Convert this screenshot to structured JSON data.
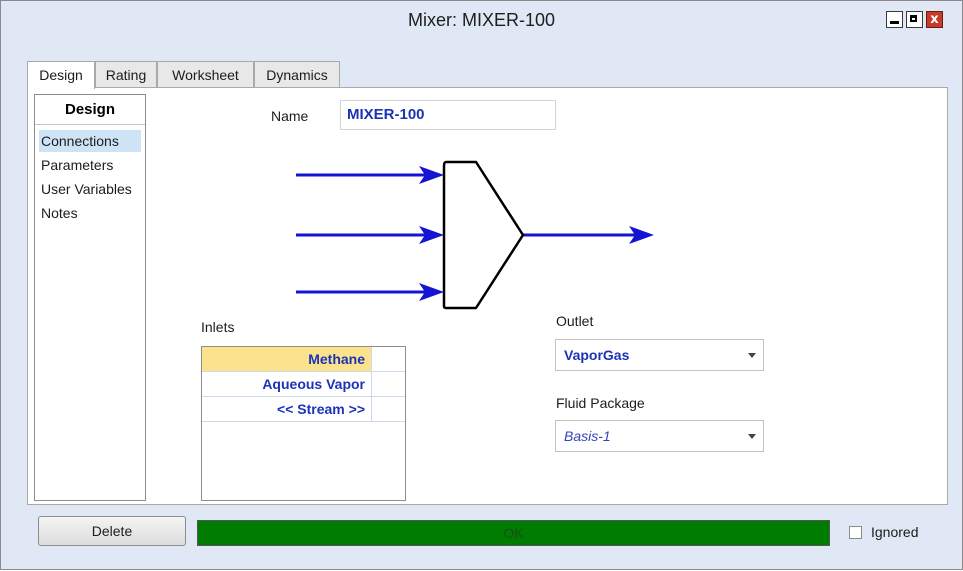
{
  "window": {
    "title": "Mixer: MIXER-100",
    "close_glyph": "x"
  },
  "tabs": [
    "Design",
    "Rating",
    "Worksheet",
    "Dynamics"
  ],
  "sidenav": {
    "title": "Design",
    "items": [
      "Connections",
      "Parameters",
      "User Variables",
      "Notes"
    ]
  },
  "name_field": {
    "label": "Name",
    "value": "MIXER-100"
  },
  "inlets": {
    "label": "Inlets",
    "rows": [
      "Methane",
      "Aqueous Vapor",
      "<< Stream >>"
    ]
  },
  "outlet": {
    "label": "Outlet",
    "value": "VaporGas"
  },
  "fluid_package": {
    "label": "Fluid Package",
    "value": "Basis-1"
  },
  "footer": {
    "delete_label": "Delete",
    "status_text": "OK",
    "ignored_label": "Ignored"
  },
  "colors": {
    "stream_arrow": "#1414d2",
    "status_ok": "#007d00",
    "selected_inlet": "#fbe28c",
    "link_text": "#1c33b8"
  }
}
